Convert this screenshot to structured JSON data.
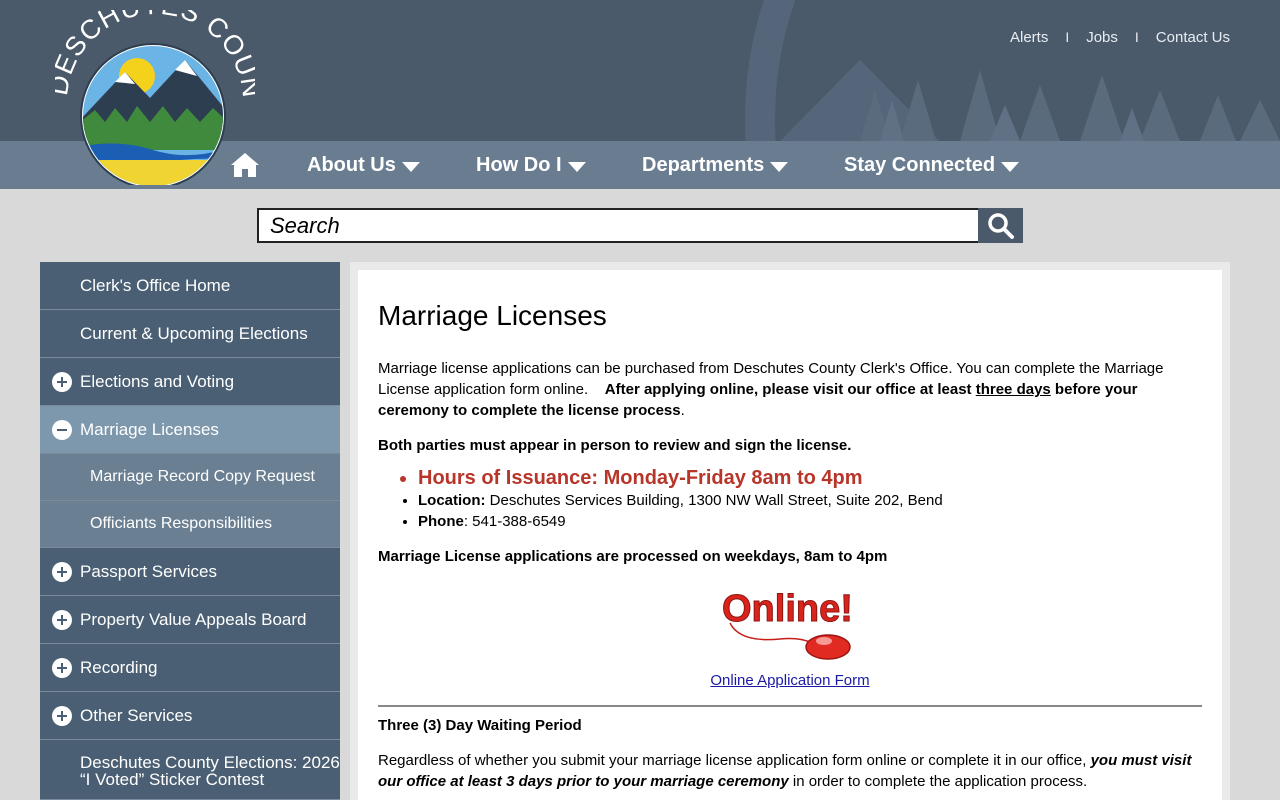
{
  "header": {
    "logo_text": "DESCHUTES COUNTY",
    "top_links": [
      "Alerts",
      "Jobs",
      "Contact Us"
    ]
  },
  "nav": {
    "items": [
      {
        "label": "About Us"
      },
      {
        "label": "How Do I"
      },
      {
        "label": "Departments"
      },
      {
        "label": "Stay Connected"
      }
    ]
  },
  "search": {
    "placeholder": "Search"
  },
  "sidebar": {
    "items": [
      {
        "label": "Clerk's Office Home"
      },
      {
        "label": "Current & Upcoming Elections"
      },
      {
        "label": "Elections and Voting"
      },
      {
        "label": "Marriage Licenses"
      },
      {
        "label": "Marriage Record Copy Request"
      },
      {
        "label": "Officiants Responsibilities"
      },
      {
        "label": "Passport Services"
      },
      {
        "label": "Property Value Appeals Board"
      },
      {
        "label": "Recording"
      },
      {
        "label": "Other Services"
      },
      {
        "label": "Deschutes County Elections: 2026 “I Voted” Sticker Contest"
      }
    ]
  },
  "main": {
    "title": "Marriage Licenses",
    "intro_1": "Marriage license applications can be purchased from Deschutes County Clerk's Office. You can complete the Marriage License application form online.",
    "intro_bold_1": "After applying online, please visit our office at least ",
    "intro_underline": "three days",
    "intro_bold_2": " before your ceremony to complete the license process",
    "intro_end": ".",
    "both_parties": "Both parties must appear in person to review and sign the license.",
    "hours": "Hours of Issuance: Monday-Friday 8am to 4pm",
    "location_label": "Location:",
    "location_value": " Deschutes Services Building, 1300 NW Wall Street, Suite 202, Bend",
    "phone_label": "Phone",
    "phone_value": ": 541-388-6549",
    "processed": "Marriage License applications are processed on weekdays, 8am to 4pm",
    "online_graphic_text": "Online!",
    "online_link": "Online Application Form",
    "waiting_title": "Three (3) Day Waiting Period",
    "waiting_text_1": "Regardless of whether you submit your marriage license application form online or complete it in our office, ",
    "waiting_bold": "you must visit our office at least 3 days prior to your marriage ceremony",
    "waiting_text_2": " in order to complete the application process."
  }
}
